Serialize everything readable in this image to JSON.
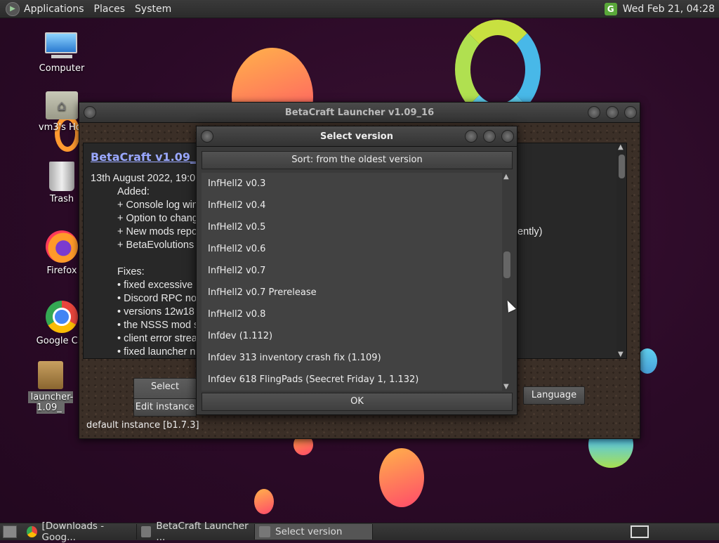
{
  "top_panel": {
    "menus": [
      "Applications",
      "Places",
      "System"
    ],
    "clock": "Wed Feb 21, 04:28"
  },
  "desktop_icons": [
    {
      "label": "Computer"
    },
    {
      "label": "vm3's Hor"
    },
    {
      "label": "Trash"
    },
    {
      "label": "Firefox"
    },
    {
      "label": "Google Chr"
    },
    {
      "label": "launcher-1.09_"
    }
  ],
  "main_window": {
    "title": "BetaCraft Launcher v1.09_16",
    "changelog_title": "BetaCraft v1.09_16 (",
    "lines": [
      "13th August 2022, 19:0",
      "Added:",
      "+ Console log win",
      "+ Option to chang",
      "+ New mods repo",
      "+ BetaEvolutions",
      "Fixes:",
      "• fixed excessive",
      "• Discord RPC no",
      "• versions 12w18",
      "• the NSSS mod s",
      "• client error strea",
      "• fixed launcher n"
    ],
    "right_fragment": "ently)",
    "buttons": {
      "select_version": "Select version",
      "edit_instance": "Edit instance",
      "language": "Language"
    },
    "instance": "default instance [b1.7.3]"
  },
  "dialog": {
    "title": "Select version",
    "sort_label": "Sort: from the oldest version",
    "items": [
      "InfHell2 v0.3",
      "InfHell2 v0.4",
      "InfHell2 v0.5",
      "InfHell2 v0.6",
      "InfHell2 v0.7",
      "InfHell2 v0.7 Prerelease",
      "InfHell2 v0.8",
      "Infdev (1.112)",
      "Infdev 313 inventory crash fix (1.109)",
      "Infdev 618 FlingPads (Seecret Friday 1, 1.132)"
    ],
    "ok_label": "OK"
  },
  "taskbar": {
    "tasks": [
      {
        "label": "[Downloads - Goog..."
      },
      {
        "label": "BetaCraft Launcher ..."
      },
      {
        "label": "Select version"
      }
    ]
  }
}
